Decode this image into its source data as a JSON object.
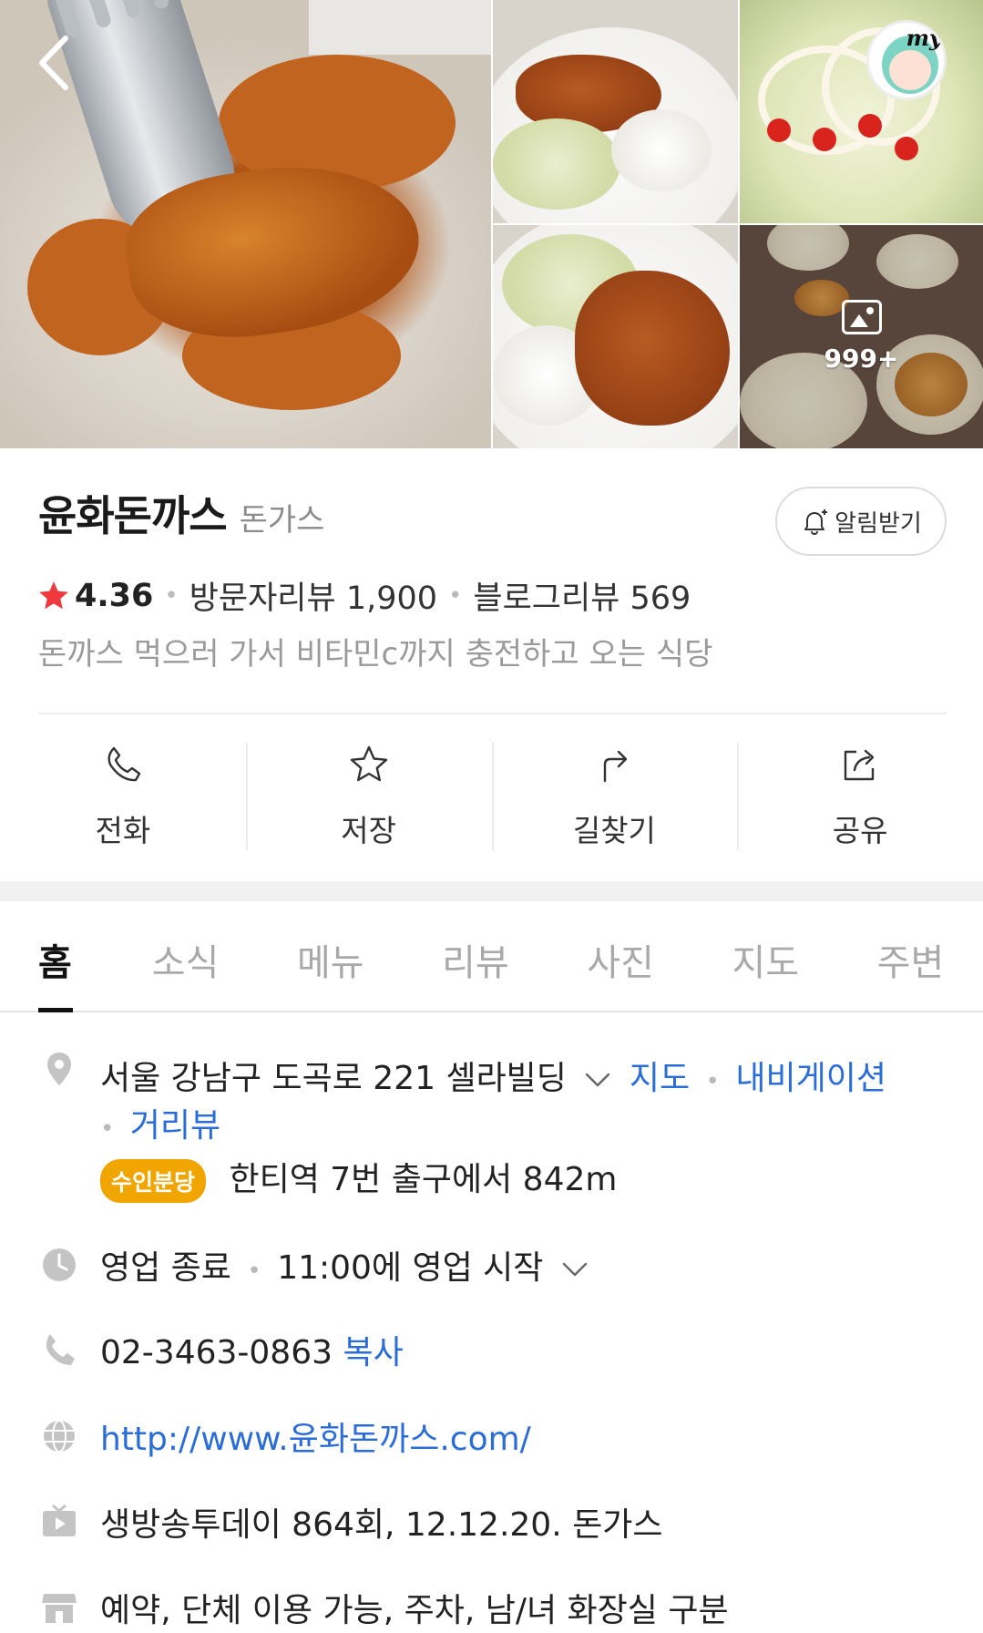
{
  "header": {
    "back_icon": "chevron-left-icon",
    "photo_count": "999+",
    "avatar_label": "my"
  },
  "place": {
    "name": "윤화돈까스",
    "category": "돈가스",
    "notify_label": "알림받기",
    "rating": "4.36",
    "visitor_reviews": "방문자리뷰 1,900",
    "blog_reviews": "블로그리뷰 569",
    "tagline": "돈까스 먹으러 가서 비타민c까지 충전하고 오는 식당"
  },
  "actions": [
    {
      "label": "전화",
      "icon": "phone-icon"
    },
    {
      "label": "저장",
      "icon": "star-icon"
    },
    {
      "label": "길찾기",
      "icon": "directions-icon"
    },
    {
      "label": "공유",
      "icon": "share-icon"
    }
  ],
  "tabs": [
    "홈",
    "소식",
    "메뉴",
    "리뷰",
    "사진",
    "지도",
    "주변"
  ],
  "info": {
    "address": "서울 강남구 도곡로 221 셀라빌딩",
    "address_links": [
      "지도",
      "내비게이션",
      "거리뷰"
    ],
    "subway_badge": "수인분당",
    "subway_text": "한티역 7번 출구에서 842m",
    "hours_status": "영업 종료",
    "hours_detail": "11:00에 영업 시작",
    "phone": "02-3463-0863",
    "phone_copy": "복사",
    "website": "http://www.윤화돈까스.com/",
    "tv": "생방송투데이 864회, 12.12.20. 돈가스",
    "facilities": "예약, 단체 이용 가능, 주차, 남/녀 화장실 구분"
  },
  "colors": {
    "link": "#2a6dd8",
    "star": "#f0383f",
    "badge": "#f0a500"
  }
}
